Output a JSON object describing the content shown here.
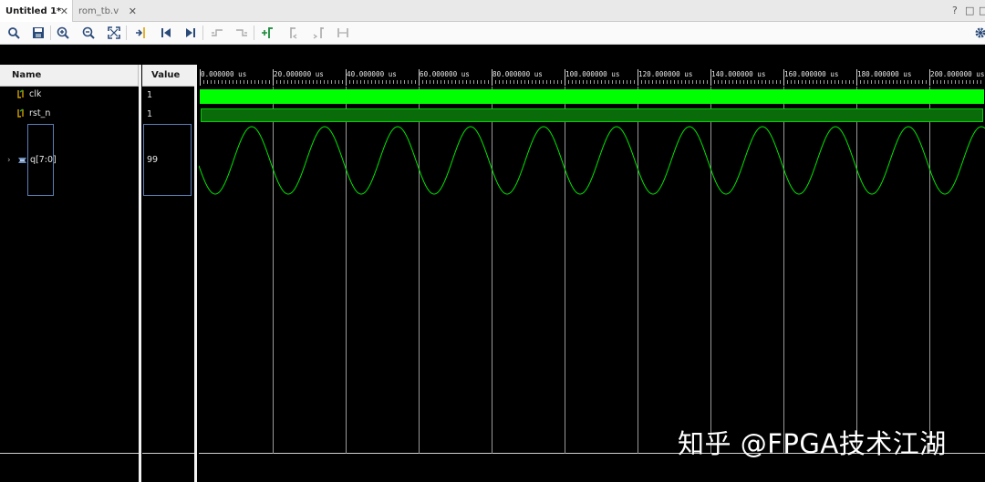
{
  "tabs": [
    {
      "label": "Untitled 1*",
      "active": true
    },
    {
      "label": "rom_tb.v",
      "active": false
    }
  ],
  "window_controls": {
    "help": "?",
    "restore": "□",
    "close": "□"
  },
  "toolbar": {
    "icons": [
      "search-icon",
      "save-icon",
      "zoom-in-icon",
      "zoom-out-icon",
      "zoom-fit-icon",
      "go-to-cursor-icon",
      "go-to-start-icon",
      "go-to-end-icon",
      "previous-transition-icon",
      "next-transition-icon",
      "add-marker-icon",
      "previous-marker-icon",
      "next-marker-icon",
      "swap-cursors-icon",
      "settings-gear-icon"
    ]
  },
  "columns": {
    "name": "Name",
    "value": "Value"
  },
  "signals": [
    {
      "name": "clk",
      "value": "1",
      "icon": "bit-signal-icon"
    },
    {
      "name": "rst_n",
      "value": "1",
      "icon": "bit-signal-icon"
    },
    {
      "name": "q[7:0]",
      "value": "99",
      "icon": "bus-signal-icon"
    }
  ],
  "ruler": {
    "labels": [
      "0.000000 us",
      "20.000000 us",
      "40.000000 us",
      "60.000000 us",
      "80.000000 us",
      "100.000000 us",
      "120.000000 us",
      "140.000000 us",
      "160.000000 us",
      "180.000000 us",
      "200.000000 us"
    ]
  },
  "waveform": {
    "clk_color": "#00ff00",
    "rst_color": "#0a6b0a",
    "analog_color": "#00e600",
    "analog_cycles_per_20us": 1
  },
  "watermark": "知乎 @FPGA技术江湖"
}
